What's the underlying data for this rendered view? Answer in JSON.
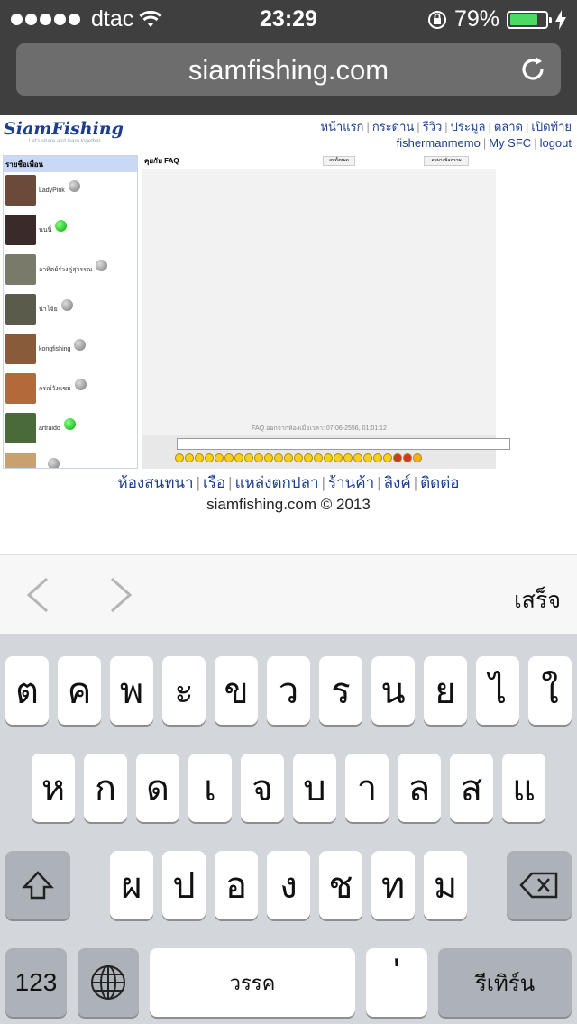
{
  "status_bar": {
    "carrier": "dtac",
    "time": "23:29",
    "battery": "79%",
    "battery_level": 0.79
  },
  "browser": {
    "url": "siamfishing.com"
  },
  "site": {
    "logo_text": "SiamFishing",
    "logo_tagline": "Let's share and learn together",
    "nav": [
      "หน้าแรก",
      "กระดาน",
      "รีวิว",
      "ประมูล",
      "ตลาด",
      "เปิดท้าย"
    ],
    "nav2": [
      "fishermanmemo",
      "My SFC",
      "logout"
    ],
    "friends_header": "รายชื่อเพื่อน",
    "friends": [
      {
        "name": "LadyPink",
        "online": false,
        "color": "#6b4a3a"
      },
      {
        "name": "นนนี่",
        "online": true,
        "color": "#3a2a2a"
      },
      {
        "name": "อาทิตย์ร่วงคู่สุวรรณ",
        "online": false,
        "color": "#7a7a6a"
      },
      {
        "name": "น้าโจ้ย",
        "online": false,
        "color": "#5b5b4b"
      },
      {
        "name": "kongfishing",
        "online": false,
        "color": "#8a5b3b"
      },
      {
        "name": "กรณ์วังแซม",
        "online": false,
        "color": "#b36a3a"
      },
      {
        "name": "artraido",
        "online": true,
        "color": "#4a6a3a"
      },
      {
        "name": "...",
        "online": false,
        "color": "#c9a070"
      }
    ],
    "chat_title": "คุยกับ FAQ",
    "chat_btn_1": "ลบทั้งหมด",
    "chat_btn_2": "ลบบางข้อความ",
    "chat_message": "FAQ ออกจากห้องเมื่อเวลา: 07-06-2556, 01:01:12",
    "footer_nav": [
      "ห้องสนทนา",
      "เรือ",
      "แหล่งตกปลา",
      "ร้านค้า",
      "ลิงค์",
      "ติดต่อ"
    ],
    "copyright": "siamfishing.com © 2013"
  },
  "form_assistant": {
    "done_label": "เสร็จ"
  },
  "keyboard": {
    "row1": [
      "ต",
      "ค",
      "พ",
      "ะ",
      "ข",
      "ว",
      "ร",
      "น",
      "ย",
      "ไ",
      "ใ"
    ],
    "row2": [
      "ห",
      "ก",
      "ด",
      "เ",
      "จ",
      "บ",
      "า",
      "ล",
      "ส",
      "แ"
    ],
    "row3": [
      "ผ",
      "ป",
      "อ",
      "ง",
      "ช",
      "ท",
      "ม"
    ],
    "numbers_label": "123",
    "space_label": "วรรค",
    "apostrophe": "'",
    "return_label": "รีเทิร์น"
  }
}
